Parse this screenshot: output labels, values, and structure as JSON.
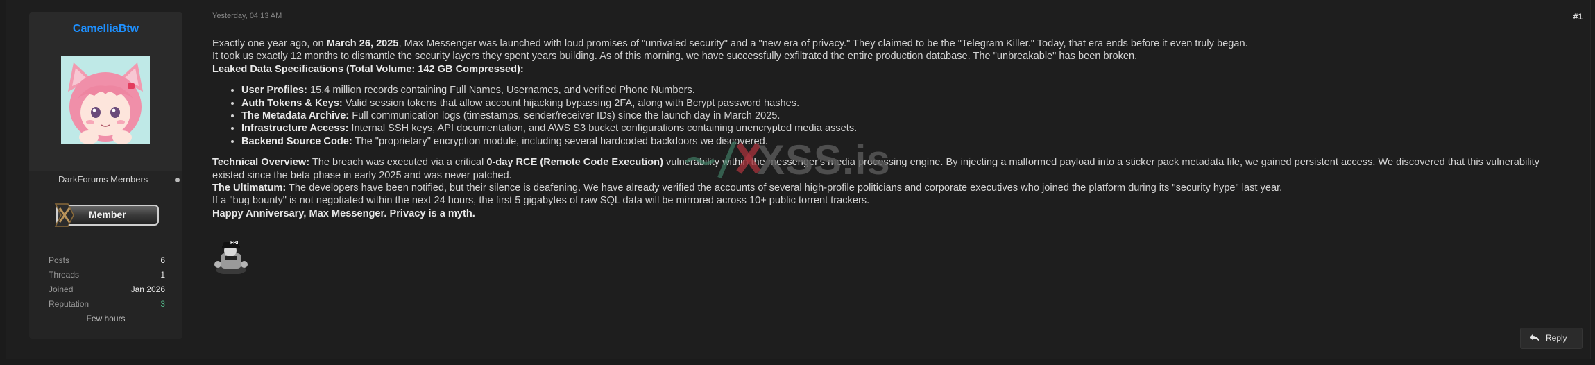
{
  "user": {
    "name": "CamelliaBtw",
    "group": "DarkForums Members",
    "rank": "Member",
    "stats": [
      {
        "label": "Posts",
        "value": "6"
      },
      {
        "label": "Threads",
        "value": "1"
      },
      {
        "label": "Joined",
        "value": "Jan 2026"
      },
      {
        "label": "Reputation",
        "value": "3"
      }
    ],
    "last_seen": "Few hours"
  },
  "post": {
    "date": "Yesterday, 04:13 AM",
    "number": "#1",
    "intro_1a": "Exactly one year ago, on ",
    "intro_1b": "March 26, 2025",
    "intro_1c": ", Max Messenger was launched with loud promises of \"unrivaled security\" and a \"new era of privacy.\" They claimed to be the \"Telegram Killer.\" Today, that era ends before it even truly began.",
    "intro_2": "It took us exactly 12 months to dismantle the security layers they spent years building. As of this morning, we have successfully exfiltrated the entire production database. The \"unbreakable\" has been broken.",
    "specs_heading": "Leaked Data Specifications (Total Volume: 142 GB Compressed):",
    "items": [
      {
        "title": "User Profiles:",
        "text": " 15.4 million records containing Full Names, Usernames, and verified Phone Numbers."
      },
      {
        "title": "Auth Tokens & Keys:",
        "text": " Valid session tokens that allow account hijacking bypassing 2FA, along with Bcrypt password hashes."
      },
      {
        "title": "The Metadata Archive:",
        "text": " Full communication logs (timestamps, sender/receiver IDs) since the launch day in March 2025."
      },
      {
        "title": "Infrastructure Access:",
        "text": " Internal SSH keys, API documentation, and AWS S3 bucket configurations containing unencrypted media assets."
      },
      {
        "title": "Backend Source Code:",
        "text": " The \"proprietary\" encryption module, including several hardcoded backdoors we discovered."
      }
    ],
    "tech_title": "Technical Overview:",
    "tech_a": " The breach was executed via a critical ",
    "tech_b": "0-day RCE (Remote Code Execution)",
    "tech_c": " vulnerability within the messenger's media processing engine. By injecting a malformed payload into a sticker pack metadata file, we gained persistent access. We discovered that this vulnerability existed since the beta phase in early 2025 and was never patched.",
    "ultimatum_title": "The Ultimatum:",
    "ultimatum_text": " The developers have been notified, but their silence is deafening. We have already verified the accounts of several high-profile politicians and corporate executives who joined the platform during its \"security hype\" last year.",
    "bug_bounty": "If a \"bug bounty\" is not negotiated within the next 24 hours, the first 5 gigabytes of raw SQL data will be mirrored across 10+ public torrent trackers.",
    "closing": "Happy Anniversary, Max Messenger. Privacy is a myth."
  },
  "signature": {
    "label": "FBI"
  },
  "watermark": {
    "text": "XSS.is"
  },
  "actions": {
    "reply": "Reply"
  },
  "icons": {
    "reply": "reply-arrow-icon",
    "online": "online-status-icon"
  },
  "colors": {
    "username": "#1e90ff",
    "reputation": "#52b788",
    "background": "#1b1b1b",
    "panel": "#242424"
  }
}
